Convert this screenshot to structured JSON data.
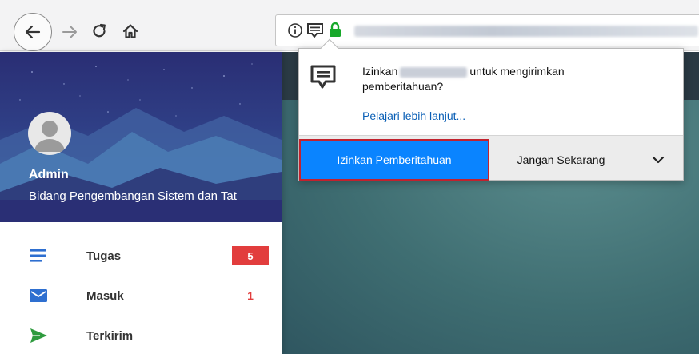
{
  "browser": {
    "url_blurred": true
  },
  "sidebar": {
    "user": {
      "name": "Admin",
      "org": "Bidang Pengembangan Sistem dan Tat"
    },
    "menu": [
      {
        "label": "Tugas",
        "badge": "5",
        "icon": "list-icon",
        "color": "#2e6fd0"
      },
      {
        "label": "Masuk",
        "badge": "1",
        "icon": "mail-icon",
        "color": "#2e6fd0"
      },
      {
        "label": "Terkirim",
        "badge": "",
        "icon": "send-icon",
        "color": "#2e9b3e"
      }
    ]
  },
  "popup": {
    "message_prefix": "Izinkan",
    "message_suffix": "untuk mengirimkan",
    "message_line2": "pemberitahuan?",
    "learn_more": "Pelajari lebih lanjut...",
    "allow_label": "Izinkan Pemberitahuan",
    "not_now_label": "Jangan Sekarang"
  },
  "colors": {
    "allow_button": "#0a84ff",
    "badge_red": "#e23d3d",
    "hero_top": "#2a2e74",
    "lock_green": "#17a82a"
  }
}
